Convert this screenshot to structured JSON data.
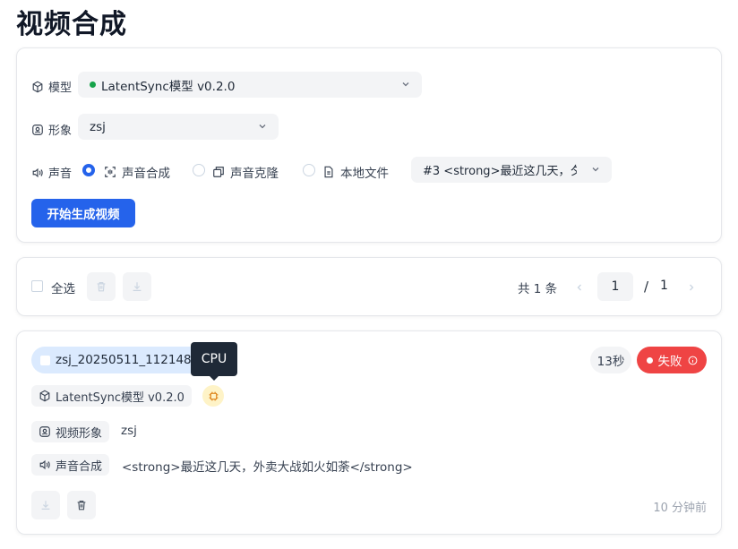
{
  "page": {
    "title": "视频合成"
  },
  "form": {
    "model": {
      "label": "模型",
      "value": "LatentSync模型 v0.2.0",
      "status_color": "#16a34a"
    },
    "avatar": {
      "label": "形象",
      "value": "zsj"
    },
    "voice": {
      "label": "声音",
      "options": [
        {
          "label": "声音合成",
          "selected": true,
          "icon": "scan-icon"
        },
        {
          "label": "声音克隆",
          "selected": false,
          "icon": "copy-icon"
        },
        {
          "label": "本地文件",
          "selected": false,
          "icon": "file-icon"
        }
      ],
      "text_select": "#3 <strong>最近这几天，夕"
    },
    "submit_label": "开始生成视频"
  },
  "toolbar": {
    "select_all_label": "全选",
    "total_text": "共 1 条",
    "current_page": "1",
    "page_separator": "/",
    "total_pages": "1"
  },
  "task": {
    "name": "zsj_20250511_112148",
    "tooltip": "CPU",
    "duration": "13秒",
    "status": "失败",
    "status_color": "#ef4444",
    "model": "LatentSync模型 v0.2.0",
    "avatar_label": "视频形象",
    "avatar_value": "zsj",
    "voice_label": "声音合成",
    "voice_value": "<strong>最近这几天，外卖大战如火如荼</strong>",
    "time_ago": "10 分钟前"
  },
  "colors": {
    "primary": "#2563eb",
    "danger": "#ef4444",
    "success": "#16a34a",
    "cpu_badge": "#fef3c7"
  }
}
